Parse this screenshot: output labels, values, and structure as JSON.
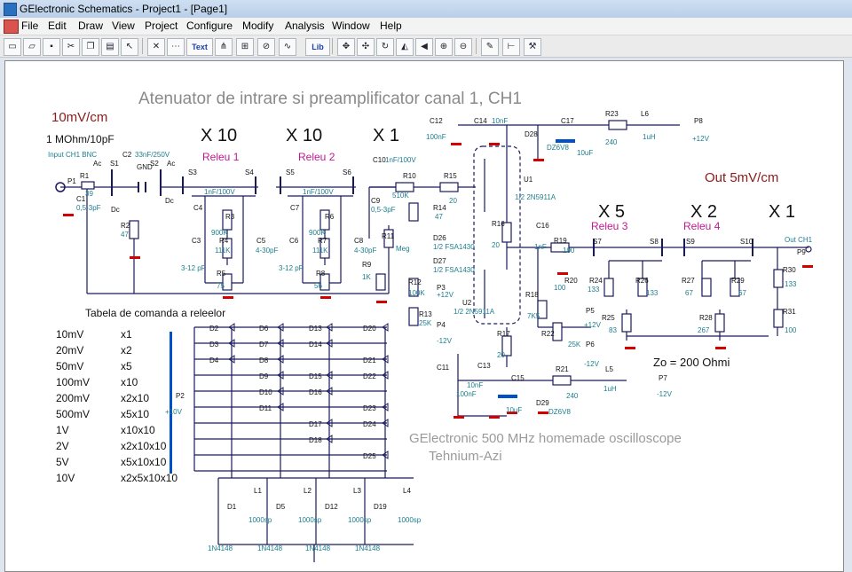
{
  "window": {
    "title": "GElectronic Schematics - Project1 - [Page1]"
  },
  "menu": {
    "items": [
      "File",
      "Edit",
      "Draw",
      "View",
      "Project",
      "Configure",
      "Modify",
      "Analysis",
      "Window",
      "Help"
    ]
  },
  "toolbar": {
    "buttons": [
      "open-icon",
      "open-folder-icon",
      "save-icon",
      "cut-icon",
      "copy-icon",
      "paste-icon",
      "pointer-icon",
      "select-area-icon",
      "bus-icon",
      "text-tool-icon",
      "pins-icon",
      "grid-icon",
      "probe-icon",
      "wave-icon",
      "components-icon",
      "lib-icon",
      "move-icon",
      "drag-icon",
      "rotate-icon",
      "mirror-icon",
      "flip-icon",
      "zoom-in-icon",
      "zoom-out-icon",
      "property-icon",
      "connect-icon",
      "tools-icon"
    ],
    "text_button_label": "Text",
    "lib_button_label": "Lib"
  },
  "schematic": {
    "title": "Atenuator de intrare si preamplificator canal 1, CH1",
    "sensitivity_in": "10mV/cm",
    "impedance": "1 MOhm/10pF",
    "input_label": "Input CH1 BNC",
    "out_label": "Out 5mV/cm",
    "out_ch1": "Out CH1",
    "zo": "Zo = 200 Ohmi",
    "footer_line1": "GElectronic 500 MHz homemade oscilloscope",
    "footer_line2": "Tehnium-Azi",
    "stages_top": [
      {
        "gain": "X 10",
        "relay": "Releu 1"
      },
      {
        "gain": "X 10",
        "relay": "Releu 2"
      },
      {
        "gain": "X 1",
        "relay": ""
      }
    ],
    "stages_out": [
      {
        "gain": "X 5",
        "relay": "Releu 3"
      },
      {
        "gain": "X 2",
        "relay": "Releu 4"
      },
      {
        "gain": "X 1",
        "relay": ""
      }
    ],
    "table_title": "Tabela de comanda a releelor",
    "table_rows": [
      {
        "range": "10mV",
        "cmd": "x1"
      },
      {
        "range": "20mV",
        "cmd": "x2"
      },
      {
        "range": "50mV",
        "cmd": "x5"
      },
      {
        "range": "100mV",
        "cmd": "x10"
      },
      {
        "range": "200mV",
        "cmd": "x2x10"
      },
      {
        "range": "500mV",
        "cmd": "x5x10"
      },
      {
        "range": "1V",
        "cmd": "x10x10"
      },
      {
        "range": "2V",
        "cmd": "x2x10x10"
      },
      {
        "range": "5V",
        "cmd": "x5x10x10"
      },
      {
        "range": "10V",
        "cmd": "x2x5x10x10"
      }
    ],
    "labels": {
      "P1": "P1",
      "R1": "R1",
      "R1v": "39",
      "C1": "C1",
      "C1v": "0,5-3pF",
      "S1": "S1",
      "Ac1": "Ac",
      "Dc1": "Dc",
      "C2": "C2",
      "C2v": "33nF/250V",
      "S2": "S2",
      "GND": "GND",
      "Ac2": "Ac",
      "Dc2": "Dc",
      "R2": "R2",
      "R2v": "47",
      "S3": "S3",
      "S4": "S4",
      "S5": "S5",
      "S6": "S6",
      "C4": "C4",
      "C4v": "1nF/100V",
      "R3": "R3",
      "R3v": "900K",
      "C3": "C3",
      "R4": "R4",
      "R4v": "111K",
      "C5": "C5",
      "C5v": "4-30pF",
      "C3v": "3-12 pF",
      "R5": "R5",
      "R5v": "75",
      "C7": "C7",
      "C7v": "1nF/100V",
      "R6": "R6",
      "R6v": "900K",
      "C6": "C6",
      "R7": "R7",
      "R7v": "111K",
      "C8": "C8",
      "C8v": "4-30pF",
      "C6v": "3-12 pF",
      "R8": "R8",
      "R8v": "56",
      "C10": "C10",
      "C10v": "1nF/100V",
      "C9": "C9",
      "C9v": "0,5-3pF",
      "R10": "R10",
      "R10v": "510K",
      "R11": "R11",
      "R11v": "Meg",
      "R9": "R9",
      "R9v": "1K",
      "R15": "R15",
      "R15v": "20",
      "R14": "R14",
      "R14v": "47",
      "D26": "D26",
      "D26v": "1/2 FSA1430",
      "D27": "D27",
      "D27v": "1/2 FSA1430",
      "R12": "R12",
      "R12v": "100K",
      "P3": "P3",
      "P3v": "+12V",
      "R13": "R13",
      "R13v": "25K",
      "P4": "P4",
      "P4v": "-12V",
      "C12": "C12",
      "C12v": "100nF",
      "C14": "C14",
      "C14v": "10nF",
      "C17": "C17",
      "C17v": "10uF",
      "D28": "D28",
      "D28v": "DZ6V8",
      "R23": "R23",
      "R23v": "240",
      "L6": "L6",
      "L6v": "1uH",
      "P8": "P8",
      "P8v": "+12V",
      "U1": "U1",
      "U1v": "1/2 2N5911A",
      "U2": "U2",
      "U2v": "1/2 2N5911A",
      "R16": "R16",
      "R16v": "20",
      "C16": "C16",
      "C16v": "1nF",
      "R19": "R19",
      "R19v": "100",
      "R20": "R20",
      "R20v": "100",
      "R18": "R18",
      "R18v": "7K5",
      "P5": "P5",
      "P5v": "+12V",
      "R22": "R22",
      "R22v": "25K",
      "P6": "P6",
      "P6v": "-12V",
      "R17": "R17",
      "R17v": "20",
      "C11": "C11",
      "C11v": "100nF",
      "C13": "C13",
      "C13v": "10nF",
      "C15": "C15",
      "C15v": "10uF",
      "D29": "D29",
      "D29v": "DZ6V8",
      "R21": "R21",
      "R21v": "240",
      "L5": "L5",
      "L5v": "1uH",
      "P7": "P7",
      "P7v": "-12V",
      "S7": "S7",
      "S8": "S8",
      "S9": "S9",
      "S10": "S10",
      "R24": "R24",
      "R24v": "133",
      "R26": "R26",
      "R26v": "133",
      "R25": "R25",
      "R25v": "83",
      "R27": "R27",
      "R27v": "67",
      "R29": "R29",
      "R29v": "67",
      "R28": "R28",
      "R28v": "267",
      "R30": "R30",
      "R30v": "133",
      "R31": "R31",
      "R31v": "100",
      "P9": "P9",
      "P2": "P2",
      "P2v": "+10V",
      "L1": "L1",
      "L2": "L2",
      "L3": "L3",
      "L4": "L4",
      "Lv": "1000sp",
      "D1": "D1",
      "D5": "D5",
      "D12": "D12",
      "D19": "D19",
      "Dv": "1N4148",
      "diodes": [
        "D2",
        "D3",
        "D4",
        "D6",
        "D7",
        "D8",
        "D9",
        "D10",
        "D11",
        "D13",
        "D14",
        "D15",
        "D16",
        "D17",
        "D18",
        "D20",
        "D21",
        "D22",
        "D23",
        "D24",
        "D25"
      ]
    }
  },
  "colors": {
    "wire": "#1a1a5a",
    "cyan_label": "#1b7f8f",
    "relay_label": "#c2188f",
    "gain": "#111111",
    "red_term": "#d40000",
    "blue_part": "#0050c8",
    "title_grey": "#8a8a8a"
  }
}
